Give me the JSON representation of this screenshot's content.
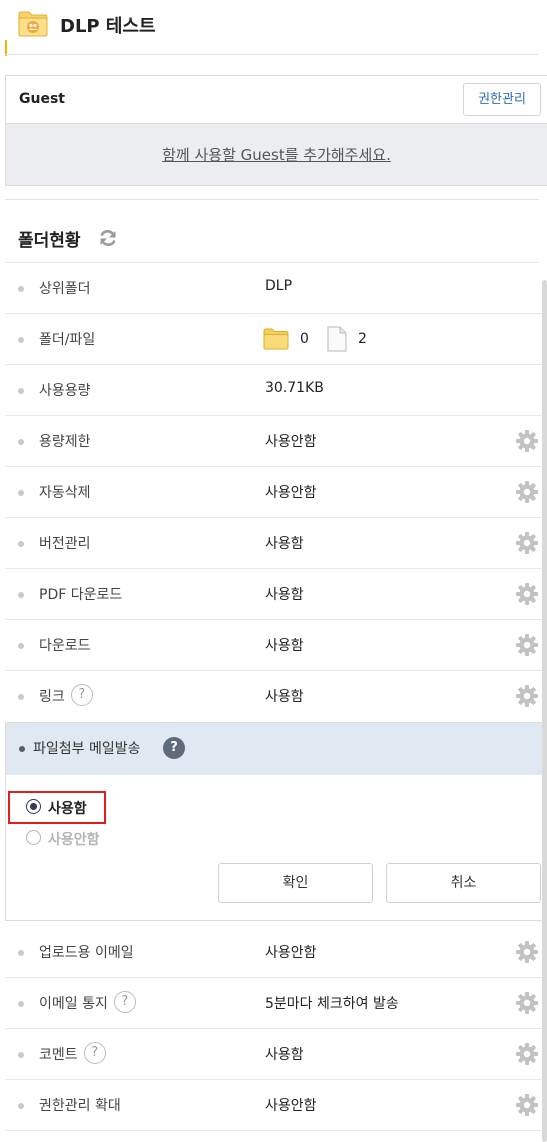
{
  "header": {
    "title": "DLP 테스트"
  },
  "guest": {
    "label": "Guest",
    "permission_button": "권한관리",
    "add_link": "함께 사용할 Guest를 추가해주세요."
  },
  "status": {
    "title": "폴더현황",
    "rows": [
      {
        "label": "상위폴더",
        "value": "DLP"
      },
      {
        "label": "폴더/파일",
        "folder_count": "0",
        "file_count": "2"
      },
      {
        "label": "사용용량",
        "value": "30.71KB"
      },
      {
        "label": "용량제한",
        "value": "사용안함"
      },
      {
        "label": "자동삭제",
        "value": "사용안함"
      },
      {
        "label": "버전관리",
        "value": "사용함"
      },
      {
        "label": "PDF 다운로드",
        "value": "사용함"
      },
      {
        "label": "다운로드",
        "value": "사용함"
      },
      {
        "label": "링크",
        "value": "사용함",
        "help": "?"
      }
    ],
    "mail_attach": {
      "label": "파일첨부 메일발송",
      "help": "?",
      "option_on": "사용함",
      "option_off": "사용안함",
      "confirm": "확인",
      "cancel": "취소"
    },
    "rows_after": [
      {
        "label": "업로드용 이메일",
        "value": "사용안함"
      },
      {
        "label": "이메일 통지",
        "value": "5분마다 체크하여 발송",
        "help": "?"
      },
      {
        "label": "코멘트",
        "value": "사용함",
        "help": "?"
      },
      {
        "label": "권한관리 확대",
        "value": "사용안함"
      }
    ]
  },
  "colors": {
    "accent": "#f2b600",
    "link": "#2f6fb5",
    "panel_bg": "#e0e9f1",
    "highlight": "#e02020"
  },
  "icons": [
    "folder-icon",
    "refresh-icon",
    "gear-icon",
    "help-icon",
    "file-icon"
  ]
}
